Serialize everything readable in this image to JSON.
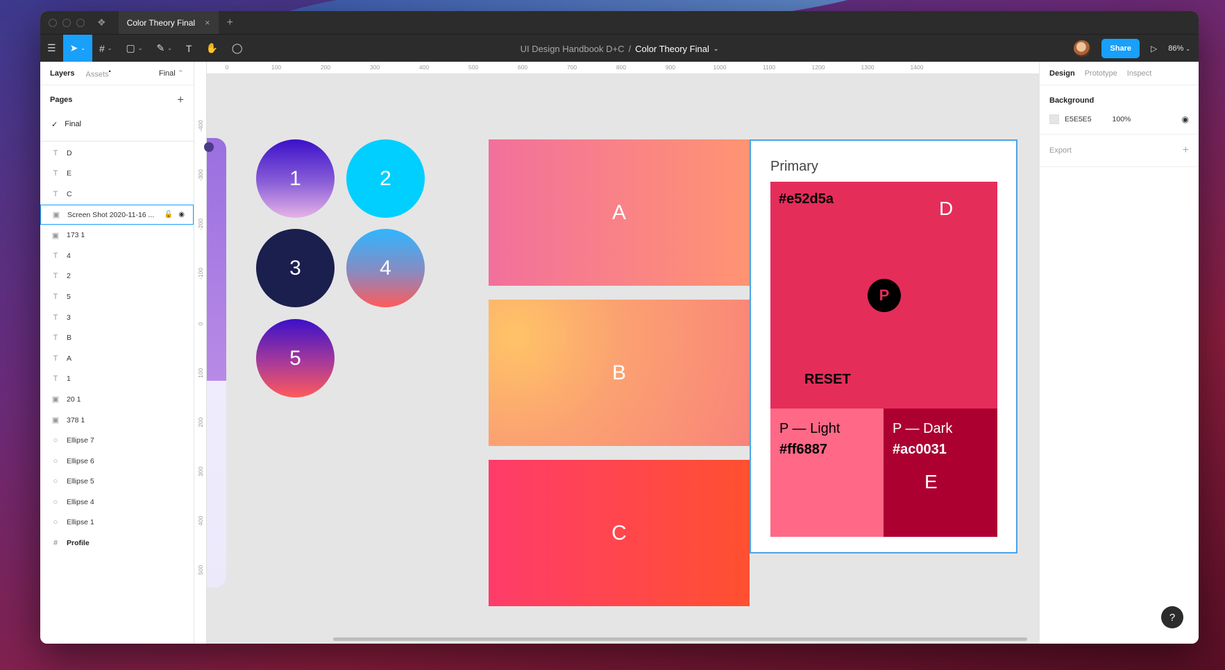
{
  "titlebar": {
    "tab_title": "Color Theory Final",
    "tab_close": "×",
    "new_tab": "+",
    "logo": "❖"
  },
  "toolbar": {
    "menu_icon": "☰",
    "move_icon": "➤",
    "frame_icon": "#",
    "shape_icon": "▢",
    "pen_icon": "✎",
    "text_icon": "T",
    "hand_icon": "✋",
    "comment_icon": "◯",
    "caret": "⌄",
    "breadcrumb_project": "UI Design Handbook D+C",
    "breadcrumb_sep": "/",
    "breadcrumb_file": "Color Theory Final",
    "share_label": "Share",
    "play_icon": "▷",
    "zoom": "86%"
  },
  "left_panel": {
    "tab_layers": "Layers",
    "tab_assets": "Assets",
    "assets_dot": "•",
    "page_selector": "Final",
    "page_selector_caret": "⌃",
    "pages_title": "Pages",
    "add_page": "+",
    "pages": [
      {
        "check": "✓",
        "name": "Final"
      }
    ],
    "layers": [
      {
        "icon": "T",
        "name": "D"
      },
      {
        "icon": "T",
        "name": "E"
      },
      {
        "icon": "T",
        "name": "C"
      },
      {
        "icon": "▣",
        "name": "Screen Shot 2020-11-16 ...",
        "selected": true,
        "lock": "🔓",
        "eye": "◉"
      },
      {
        "icon": "▣",
        "name": "173 1"
      },
      {
        "icon": "T",
        "name": "4"
      },
      {
        "icon": "T",
        "name": "2"
      },
      {
        "icon": "T",
        "name": "5"
      },
      {
        "icon": "T",
        "name": "3"
      },
      {
        "icon": "T",
        "name": "B"
      },
      {
        "icon": "T",
        "name": "A"
      },
      {
        "icon": "T",
        "name": "1"
      },
      {
        "icon": "▣",
        "name": "20 1"
      },
      {
        "icon": "▣",
        "name": "378 1"
      },
      {
        "icon": "○",
        "name": "Ellipse 7"
      },
      {
        "icon": "○",
        "name": "Ellipse 6"
      },
      {
        "icon": "○",
        "name": "Ellipse 5"
      },
      {
        "icon": "○",
        "name": "Ellipse 4"
      },
      {
        "icon": "○",
        "name": "Ellipse 1"
      },
      {
        "icon": "#",
        "name": "Profile",
        "bold": true
      }
    ]
  },
  "canvas": {
    "ruler_h": [
      "0",
      "100",
      "200",
      "300",
      "400",
      "500",
      "600",
      "700",
      "800",
      "900",
      "1000",
      "1100",
      "1200",
      "1300",
      "1400"
    ],
    "ruler_v": [
      "-400",
      "-300",
      "-200",
      "-100",
      "0",
      "100",
      "200",
      "300",
      "400",
      "500"
    ],
    "circles": [
      {
        "label": "1",
        "bg": "linear-gradient(180deg,#3b10c9 0%,#8a5fd8 55%,#e6b3e6 100%)"
      },
      {
        "label": "2",
        "bg": "#00cfff"
      },
      {
        "label": "3",
        "bg": "#1a1f4e"
      },
      {
        "label": "4",
        "bg": "linear-gradient(180deg,#2fb6ff 0%,#8a8ac0 55%,#ff5a5a 100%)"
      },
      {
        "label": "5",
        "bg": "linear-gradient(180deg,#3b10c9 0%,#a73a9a 55%,#ff5a5a 100%)"
      }
    ],
    "rects": [
      {
        "label": "A",
        "bg": "linear-gradient(90deg,#f2709c 0%,#ff9472 100%)"
      },
      {
        "label": "B",
        "bg": "radial-gradient(circle at 10% 25%,#ffc467 0%,#fba271 40%,#f9837a 100%)"
      },
      {
        "label": "C",
        "bg": "linear-gradient(90deg,#ff3c6a 0%,#ff5030 100%)"
      }
    ],
    "card": {
      "title": "Primary",
      "primary_hex": "#e52d5a",
      "primary_color": "#e52d5a",
      "letter_d": "D",
      "badge": "P",
      "reset": "RESET",
      "light_label": "P — Light",
      "light_hex": "#ff6887",
      "light_color": "#ff6887",
      "dark_label": "P — Dark",
      "dark_hex": "#ac0031",
      "dark_color": "#ac0031",
      "letter_e": "E"
    }
  },
  "right_panel": {
    "tab_design": "Design",
    "tab_prototype": "Prototype",
    "tab_inspect": "Inspect",
    "background_title": "Background",
    "background_hex": "E5E5E5",
    "background_opacity": "100%",
    "eye_icon": "◉",
    "export_label": "Export",
    "export_add": "+"
  },
  "help_label": "?"
}
